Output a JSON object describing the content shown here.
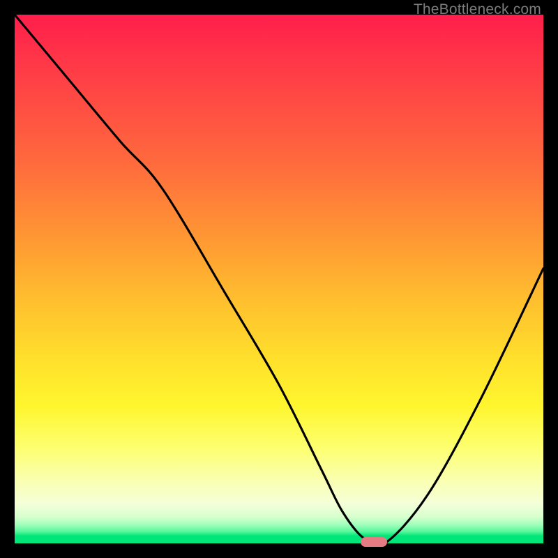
{
  "watermark": "TheBottleneck.com",
  "colors": {
    "page_bg": "#000000",
    "gradient_top": "#ff1e4b",
    "gradient_mid": "#ffe22c",
    "gradient_bottom": "#00e678",
    "curve": "#000000",
    "marker": "#e67b84",
    "watermark_text": "#7c7c7c"
  },
  "chart_data": {
    "type": "line",
    "title": "",
    "xlabel": "",
    "ylabel": "",
    "xlim": [
      0,
      100
    ],
    "ylim": [
      0,
      100
    ],
    "grid": false,
    "legend": false,
    "series": [
      {
        "name": "bottleneck-curve",
        "x": [
          0,
          10,
          20,
          28,
          40,
          50,
          58,
          62,
          66,
          70,
          78,
          88,
          100
        ],
        "y": [
          100,
          88,
          76,
          67,
          47,
          30,
          14,
          6,
          1,
          0,
          9,
          27,
          52
        ]
      }
    ],
    "optimum_marker": {
      "x": 68,
      "y": 0
    },
    "note": "x and y are approximate percentages of the plot area; y=0 is the bottom (green), y=100 is the top (red). Values estimated from pixels."
  }
}
